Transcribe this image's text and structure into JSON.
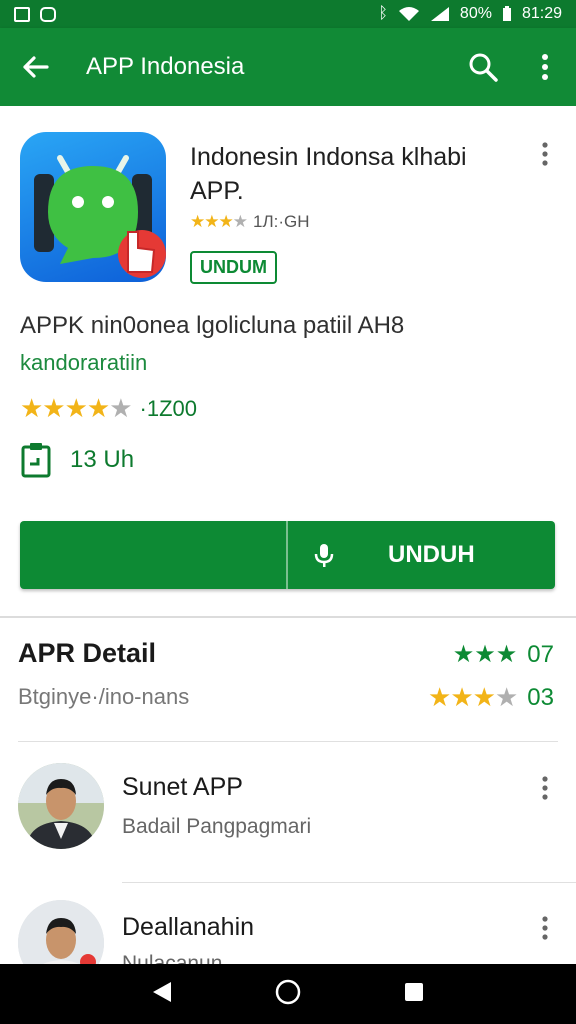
{
  "status_bar": {
    "battery": "80%",
    "time": "81:29"
  },
  "app_bar": {
    "title": "APP Indonesia"
  },
  "app": {
    "name": "Indonesin Indonsa klhabi APP.",
    "small_rating_text": "1Л:·GH",
    "badge": "UNDUM",
    "description": "APPK nin0onea lgolicluna patiil AH8",
    "developer": "kandoraratiin",
    "rating_count": "·1Z00",
    "size": "13 Uh",
    "install_label": "UNDUH"
  },
  "details": {
    "title": "APR Detail",
    "subtitle": "Btginye·/ino-nans",
    "rating1_value": "07",
    "rating2_value": "03"
  },
  "list": [
    {
      "title": "Sunet APP",
      "subtitle": "Badail Pangpagmari"
    },
    {
      "title": "Deallanahin",
      "subtitle": "Nulacanun"
    }
  ],
  "colors": {
    "primary": "#118a36",
    "status": "#0d7a2e",
    "star": "#f2b418"
  }
}
